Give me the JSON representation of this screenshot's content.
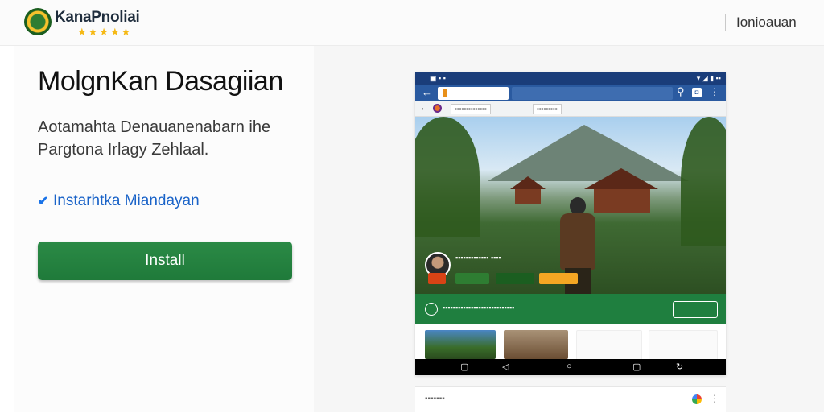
{
  "header": {
    "brand": "KanaPnoliai",
    "rating_stars": "★★★★★",
    "top_link": "Ionioauan"
  },
  "main": {
    "title": "MolgnKan Dasagiian",
    "description": "Aotamahta Denauanenabarn ihe Pargtona Irlagy Zehlaal.",
    "feature": "Instarhtka Miandayan",
    "install_label": "Install"
  },
  "colors": {
    "accent_green": "#1f7a3a",
    "link_blue": "#1a63c8",
    "phone_appbar": "#2a5aa0"
  }
}
